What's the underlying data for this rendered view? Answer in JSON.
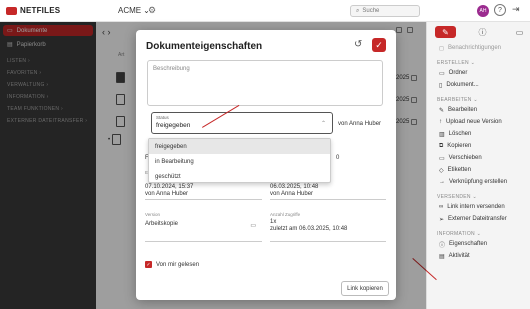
{
  "header": {
    "logo": "NETFILES",
    "workspace": "ACME",
    "search_placeholder": "Suche",
    "avatar_initials": "AH"
  },
  "sidebar": {
    "items": [
      {
        "label": "Dokumente",
        "active": true
      },
      {
        "label": "Papierkorb",
        "active": false
      }
    ],
    "sections": [
      "LISTEN",
      "FAVORITEN",
      "VERWALTUNG",
      "INFORMATION",
      "TEAM FUNKTIONEN",
      "EXTERNER DATEITRANSFER"
    ]
  },
  "background": {
    "col_header": "Art",
    "dates": [
      "2025",
      "2025",
      "2025"
    ],
    "owner": "von Anna Huber"
  },
  "modal": {
    "title": "Dokumenteigenschaften",
    "description_placeholder": "Beschreibung",
    "status_label": "Status",
    "status_value": "freigegeben",
    "options": [
      "freigegeben",
      "in Bearbeitung",
      "geschützt"
    ],
    "created_label": "Erstellt",
    "created_date": "07.10.2024, 15:37",
    "created_by": "von Anna Huber",
    "changed_label": "Geändert",
    "changed_date": "06.03.2025, 10:48",
    "changed_by": "von Anna Huber",
    "version_label": "Version",
    "version_value": "Arbeitskopie",
    "access_label": "Anzahl Zugriffe",
    "access_count": "1x",
    "access_last": "zuletzt am 06.03.2025, 10:48",
    "read_label": "Von mir gelesen",
    "copy_link": "Link kopieren",
    "hidden_f": "F",
    "hidden_num": "0"
  },
  "rightpanel": {
    "benachrichtigungen": "Benachrichtigungen",
    "erstellen_head": "ERSTELLEN",
    "ordner": "Ordner",
    "dokument": "Dokument...",
    "bearbeiten_head": "BEARBEITEN",
    "bearbeiten": "Bearbeiten",
    "upload": "Upload neue Version",
    "loeschen": "Löschen",
    "kopieren": "Kopieren",
    "verschieben": "Verschieben",
    "etiketten": "Etiketten",
    "verknuepfung": "Verknüpfung erstellen",
    "versenden_head": "VERSENDEN",
    "link_intern": "Link intern versenden",
    "externer": "Externer Dateitransfer",
    "information_head": "INFORMATION",
    "eigenschaften": "Eigenschaften",
    "aktivitaet": "Aktivität"
  },
  "colors": {
    "accent": "#c62828",
    "sidebar_bg": "#3a3a3a"
  }
}
